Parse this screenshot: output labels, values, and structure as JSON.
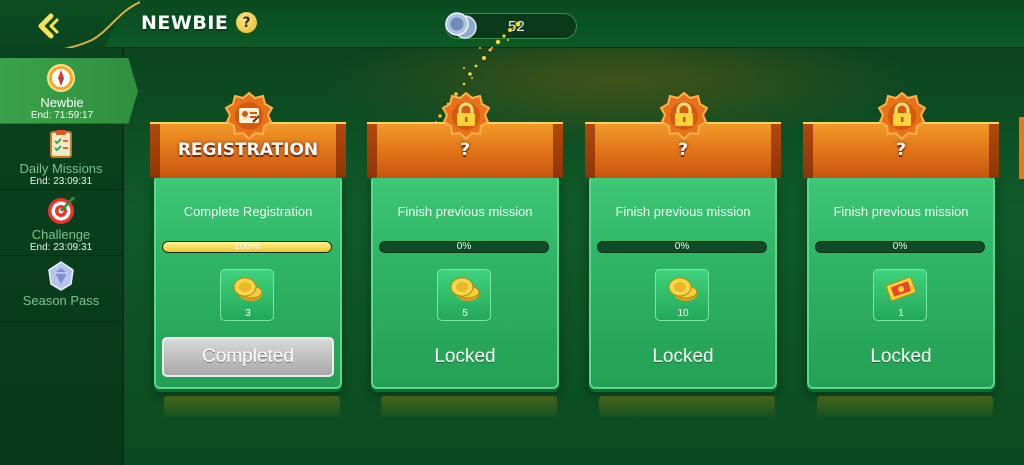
{
  "header": {
    "title": "NEWBIE",
    "help_label": "?",
    "balance": "52"
  },
  "sidebar": {
    "items": [
      {
        "label": "Newbie",
        "end": "End: 71:59:17",
        "icon": "compass-icon",
        "active": true
      },
      {
        "label": "Daily Missions",
        "end": "End: 23:09:31",
        "icon": "clipboard-icon",
        "active": false
      },
      {
        "label": "Challenge",
        "end": "End: 23:09:31",
        "icon": "target-icon",
        "active": false
      },
      {
        "label": "Season Pass",
        "end": "",
        "icon": "diamond-badge-icon",
        "active": false
      }
    ]
  },
  "missions": [
    {
      "title": "REGISTRATION",
      "badge_icon": "id-card-icon",
      "description": "Complete Registration",
      "progress": 100,
      "progress_text": "100%",
      "reward_icon": "coins-icon",
      "reward_qty": "3",
      "status": "Completed"
    },
    {
      "title": "?",
      "badge_icon": "lock-icon",
      "description": "Finish previous mission",
      "progress": 0,
      "progress_text": "0%",
      "reward_icon": "coins-icon",
      "reward_qty": "5",
      "status": "Locked"
    },
    {
      "title": "?",
      "badge_icon": "lock-icon",
      "description": "Finish previous mission",
      "progress": 0,
      "progress_text": "0%",
      "reward_icon": "coins-icon",
      "reward_qty": "10",
      "status": "Locked"
    },
    {
      "title": "?",
      "badge_icon": "lock-icon",
      "description": "Finish previous mission",
      "progress": 0,
      "progress_text": "0%",
      "reward_icon": "ticket-icon",
      "reward_qty": "1",
      "status": "Locked"
    }
  ],
  "colors": {
    "accent_orange": "#e4781b",
    "card_green": "#2fb465",
    "progress_gold": "#f1c52a"
  }
}
